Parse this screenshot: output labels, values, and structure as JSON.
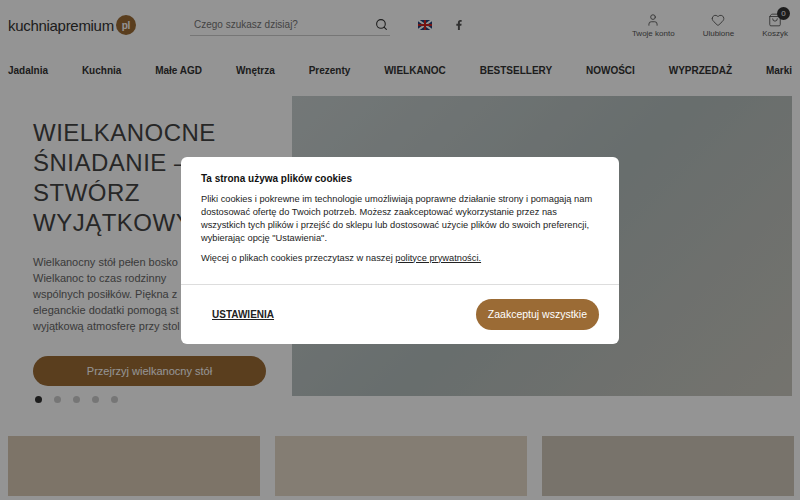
{
  "header": {
    "logo": {
      "name": "kuchniapremium",
      "badge": "pl"
    },
    "search": {
      "placeholder": "Czego szukasz dzisiaj?"
    },
    "actions": [
      {
        "label": "Twoje konto",
        "kind": "user"
      },
      {
        "label": "Ulubione",
        "kind": "heart"
      },
      {
        "label": "Koszyk",
        "kind": "cart",
        "badge": "0"
      }
    ]
  },
  "nav": [
    "Jadalnia",
    "Kuchnia",
    "Małe AGD",
    "Wnętrza",
    "Prezenty",
    "WIELKANOC",
    "BESTSELLERY",
    "NOWOŚCI",
    "WYPRZEDAŻ",
    "Marki"
  ],
  "hero": {
    "title": "WIELKANOCNE ŚNIADANIE – STWÓRZ WYJĄTKOWY S",
    "lines": [
      "Wielkanocny stół pełen bosko",
      "Wielkanoc to czas rodzinny",
      "wspólnych posiłków. Piękna z",
      "eleganckie dodatki pomogą st",
      "wyjątkową atmosferę przy stol"
    ],
    "button": "Przejrzyj wielkanocny stół",
    "dots": [
      {
        "selected": true
      },
      {
        "selected": false
      },
      {
        "selected": false
      },
      {
        "selected": false
      },
      {
        "selected": false
      }
    ]
  },
  "cards": 3,
  "cookie_dialog": {
    "title": "Ta strona używa plików cookies",
    "body": "Pliki cookies i pokrewne im technologie umożliwiają poprawne działanie strony i pomagają nam dostosować ofertę do Twoich potrzeb. Możesz zaakceptować wykorzystanie przez nas wszystkich tych plików i przejść do sklepu lub dostosować użycie plików do swoich preferencji, wybierając opcję \"Ustawienia\".",
    "more": {
      "prefix": "Więcej o plikach cookies przeczytasz w naszej ",
      "link": "polityce prywatności."
    },
    "buttons": {
      "settings": "USTAWIENIA",
      "accept": "Zaakceptuj wszystkie"
    }
  }
}
